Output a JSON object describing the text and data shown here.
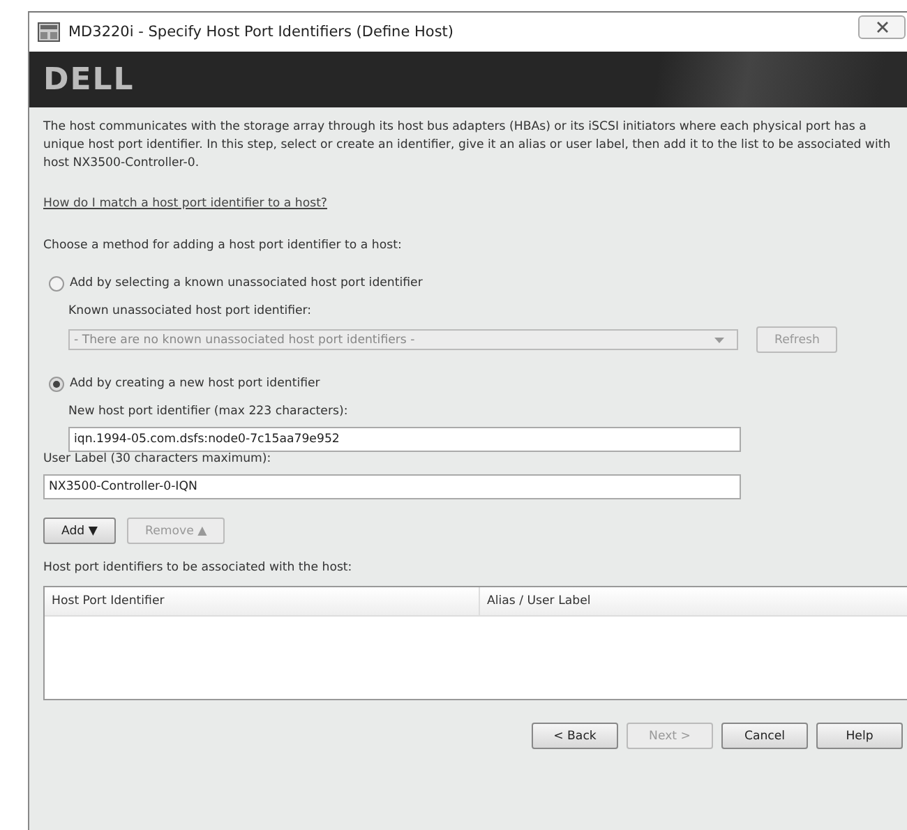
{
  "window": {
    "title": "MD3220i - Specify Host Port Identifiers (Define Host)"
  },
  "banner": {
    "logo": "DELL"
  },
  "description": "The host communicates with the storage array through its host bus adapters (HBAs) or its iSCSI initiators where each physical port has a unique host port identifier. In this step, select or create an identifier, give it an alias or user label, then add it to the list to be associated with host NX3500-Controller-0.",
  "help_link": "How do I match a host port identifier to a host?",
  "method_prompt": "Choose a method for adding a host port identifier to a host:",
  "methods": [
    {
      "label": "Add by selecting a known unassociated host port identifier",
      "selected": false,
      "kind": "select",
      "field_label": "Known unassociated host port identifier:",
      "value": "- There are no known unassociated host port identifiers -",
      "disabled": true,
      "button": {
        "label": "Refresh",
        "disabled": true
      }
    },
    {
      "label": "Add by creating a new host port identifier",
      "selected": true,
      "kind": "text",
      "field_label": "New host port identifier (max 223 characters):",
      "value": "iqn.1994-05.com.dsfs:node0-7c15aa79e952",
      "disabled": false
    }
  ],
  "user_label": {
    "label": "User Label (30 characters maximum):",
    "value": "NX3500-Controller-0-IQN"
  },
  "list_buttons": [
    {
      "label": "Add ▼",
      "disabled": false
    },
    {
      "label": "Remove ▲",
      "disabled": true
    }
  ],
  "table": {
    "caption": "Host port identifiers to be associated with the host:",
    "columns": [
      "Host Port Identifier",
      "Alias / User Label"
    ]
  },
  "footer_buttons": [
    {
      "label": "< Back",
      "disabled": false
    },
    {
      "label": "Next >",
      "disabled": true
    },
    {
      "label": "Cancel",
      "disabled": false
    },
    {
      "label": "Help",
      "disabled": false
    }
  ]
}
